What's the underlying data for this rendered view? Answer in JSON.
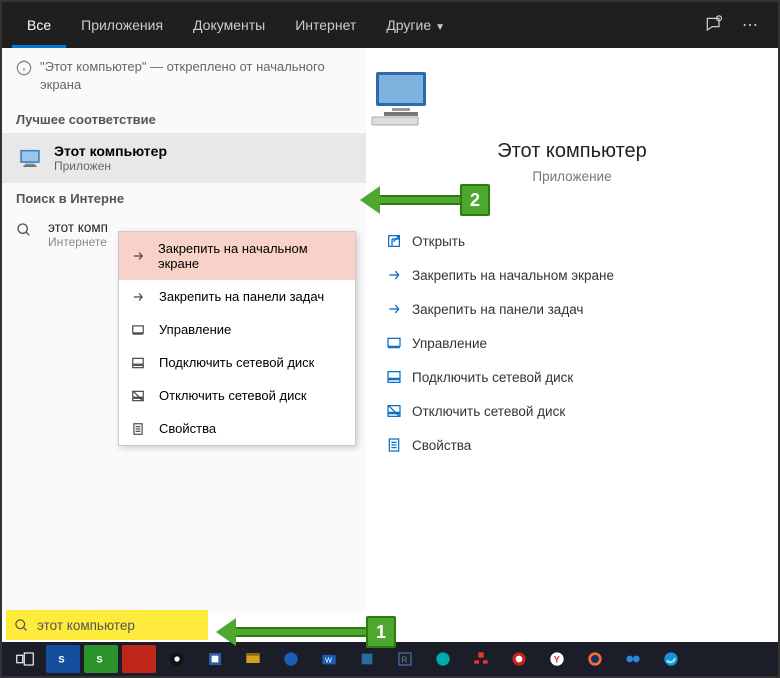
{
  "tabs": [
    {
      "label": "Все",
      "active": true
    },
    {
      "label": "Приложения",
      "active": false
    },
    {
      "label": "Документы",
      "active": false
    },
    {
      "label": "Интернет",
      "active": false
    },
    {
      "label": "Другие",
      "active": false,
      "dropdown": true
    }
  ],
  "notice": {
    "text": "\"Этот компьютер\" — откреплено от начального экрана"
  },
  "left": {
    "best_match_header": "Лучшее соответствие",
    "result_title": "Этот компьютер",
    "result_sub": "Приложен",
    "web_header": "Поиск в Интерне",
    "web_title": "этот комп",
    "web_sub": "Интернете"
  },
  "context_menu": [
    {
      "label": "Закрепить на начальном экране",
      "highlight": true,
      "icon": "pin"
    },
    {
      "label": "Закрепить на панели задач",
      "icon": "pin"
    },
    {
      "label": "Управление",
      "icon": "manage"
    },
    {
      "label": "Подключить сетевой диск",
      "icon": "netdrive"
    },
    {
      "label": "Отключить сетевой диск",
      "icon": "netdrive-off"
    },
    {
      "label": "Свойства",
      "icon": "props"
    }
  ],
  "preview": {
    "title": "Этот компьютер",
    "sub": "Приложение",
    "actions": [
      {
        "label": "Открыть",
        "icon": "open"
      },
      {
        "label": "Закрепить на начальном экране",
        "icon": "pin"
      },
      {
        "label": "Закрепить на панели задач",
        "icon": "pin"
      },
      {
        "label": "Управление",
        "icon": "manage"
      },
      {
        "label": "Подключить сетевой диск",
        "icon": "netdrive"
      },
      {
        "label": "Отключить сетевой диск",
        "icon": "netdrive-off"
      },
      {
        "label": "Свойства",
        "icon": "props"
      }
    ]
  },
  "callouts": {
    "one": "1",
    "two": "2"
  },
  "search": {
    "value": "этот компьютер"
  }
}
